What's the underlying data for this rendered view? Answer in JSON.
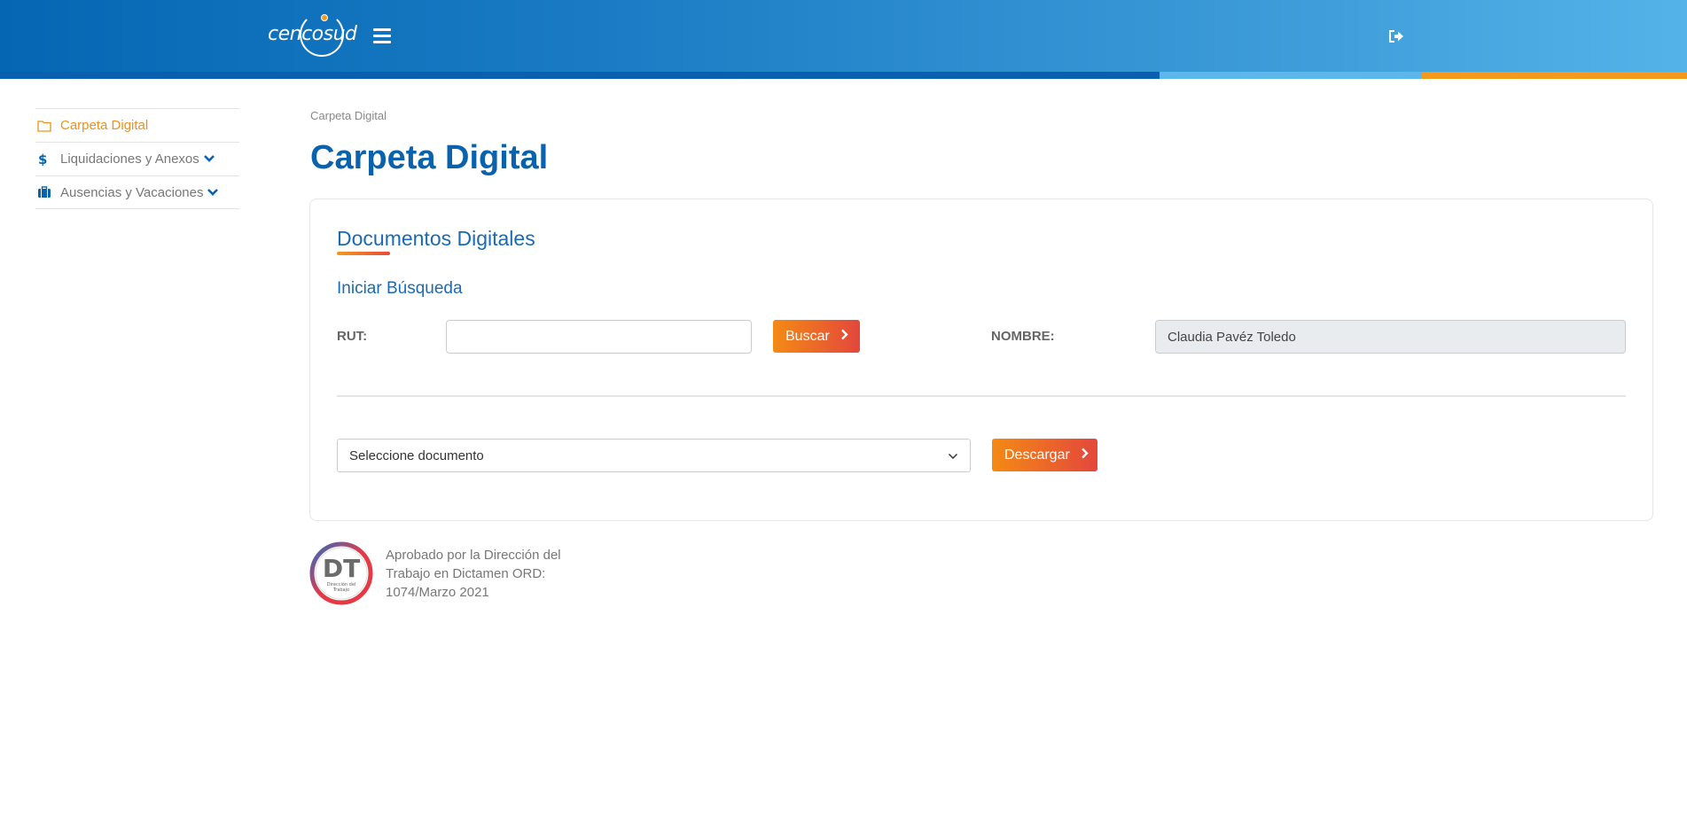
{
  "header": {
    "logo_text": "cencosud",
    "colors": {
      "primary": "#0567b3",
      "accent": "#f39a1b",
      "light": "#54b3e8"
    },
    "menu_icon": "hamburger-icon",
    "logout_icon": "sign-out-icon"
  },
  "sidebar": {
    "items": [
      {
        "label": "Carpeta Digital",
        "icon": "folder-icon",
        "active": true
      },
      {
        "label": "Liquidaciones y Anexos",
        "icon": "dollar-icon",
        "active": false,
        "expandable": true
      },
      {
        "label": "Ausencias y Vacaciones",
        "icon": "briefcase-icon",
        "active": false,
        "expandable": true
      }
    ]
  },
  "main": {
    "breadcrumb": "Carpeta Digital",
    "title": "Carpeta Digital",
    "card": {
      "title": "Documentos Digitales",
      "subtitle": "Iniciar Búsqueda",
      "rut_label": "RUT:",
      "rut_value": "",
      "buscar_label": "Buscar",
      "nombre_label": "NOMBRE:",
      "nombre_value": "Claudia Pavéz Toledo",
      "select_value": "Seleccione documento",
      "descargar_label": "Descargar"
    }
  },
  "footer": {
    "seal_text": "DT",
    "seal_subtext": "Dirección del Trabajo",
    "line1": "Aprobado por la Dirección del",
    "line2": "Trabajo en Dictamen ORD:",
    "line3": "1074/Marzo 2021"
  }
}
